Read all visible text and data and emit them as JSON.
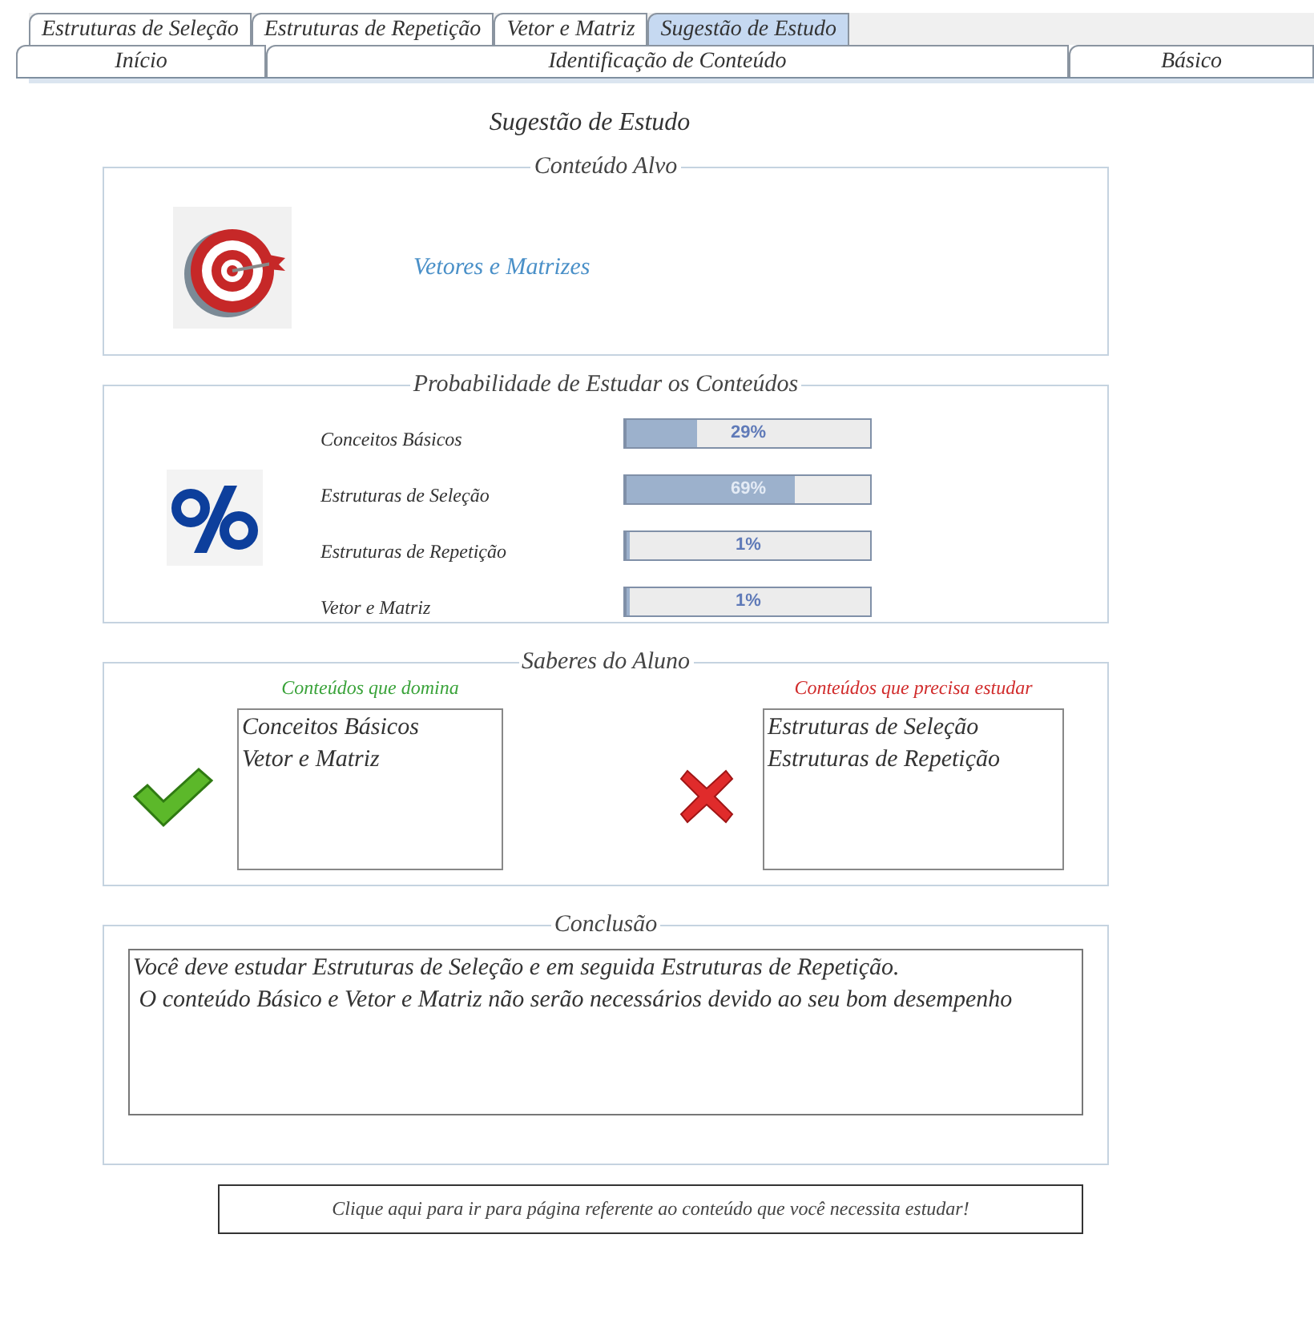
{
  "tab_rows": [
    [
      {
        "label": "Estruturas de Seleção",
        "selected": false
      },
      {
        "label": "Estruturas de Repetição",
        "selected": false
      },
      {
        "label": "Vetor e Matriz",
        "selected": false
      },
      {
        "label": "Sugestão de Estudo",
        "selected": true
      }
    ],
    [
      {
        "label": "Início",
        "selected": false
      },
      {
        "label": "Identificação de Conteúdo",
        "selected": false
      },
      {
        "label": "Básico",
        "selected": false
      }
    ]
  ],
  "page_title": "Sugestão de Estudo",
  "target_section": {
    "title": "Conteúdo Alvo",
    "content": "Vetores e Matrizes"
  },
  "probability_section": {
    "title": "Probabilidade de Estudar os Conteúdos",
    "rows": [
      {
        "name": "Conceitos Básicos",
        "level": 0.29,
        "reading": "29%"
      },
      {
        "name": "Estruturas de Seleção",
        "level": 0.69,
        "reading": "69%"
      },
      {
        "name": "Estruturas de Repetição",
        "level": 0.01,
        "reading": "1%"
      },
      {
        "name": "Vetor e Matriz",
        "level": 0.01,
        "reading": "1%"
      }
    ]
  },
  "knowledge_section": {
    "title": "Saberes do Aluno",
    "lists": [
      {
        "kind": "known",
        "heading": "Conteúdos que domina",
        "items": [
          "Conceitos Básicos",
          "Vetor e Matriz"
        ]
      },
      {
        "kind": "needed",
        "heading": "Conteúdos que precisa estudar",
        "items": [
          "Estruturas de Seleção",
          "Estruturas de Repetição"
        ]
      }
    ]
  },
  "conclusion_section": {
    "title": "Conclusão",
    "text": "Você deve estudar Estruturas de Seleção e em seguida Estruturas de Repetição.\n O conteúdo Básico e Vetor e Matriz não serão necessários devido ao seu bom desempenho"
  },
  "action_button": "Clique aqui para ir para página referente ao conteúdo que você necessita estudar!"
}
